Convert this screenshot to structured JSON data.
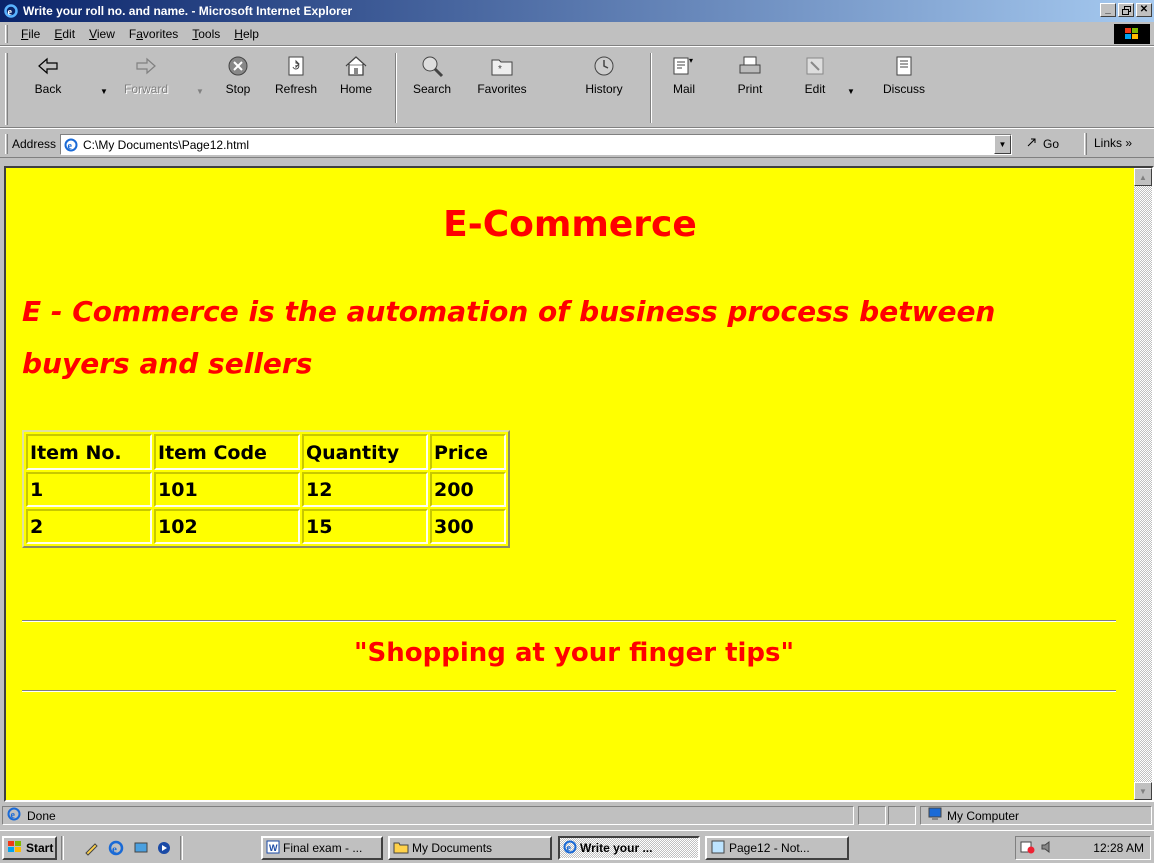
{
  "window": {
    "title": "Write your roll no. and name. - Microsoft Internet Explorer",
    "minimize": "_",
    "maximize": "▫",
    "close": "✕"
  },
  "menu": {
    "items": [
      {
        "label": "File",
        "accel": "F",
        "rest": "ile"
      },
      {
        "label": "Edit",
        "accel": "E",
        "rest": "dit"
      },
      {
        "label": "View",
        "accel": "V",
        "rest": "iew"
      },
      {
        "label": "Favorites",
        "accel": "a",
        "pre": "F",
        "rest": "vorites"
      },
      {
        "label": "Tools",
        "accel": "T",
        "rest": "ools"
      },
      {
        "label": "Help",
        "accel": "H",
        "rest": "elp"
      }
    ]
  },
  "toolbar": {
    "back": "Back",
    "forward": "Forward",
    "stop": "Stop",
    "refresh": "Refresh",
    "home": "Home",
    "search": "Search",
    "favorites": "Favorites",
    "history": "History",
    "mail": "Mail",
    "print": "Print",
    "edit": "Edit",
    "discuss": "Discuss"
  },
  "address": {
    "label": "Address",
    "url": "C:\\My Documents\\Page12.html",
    "go": "Go",
    "links": "Links »"
  },
  "page": {
    "heading": "E-Commerce",
    "description": "E - Commerce is the automation of business process between buyers and sellers",
    "table": {
      "headers": [
        "Item No.",
        "Item Code",
        "Quantity",
        "Price"
      ],
      "rows": [
        [
          "1",
          "101",
          "12",
          "200"
        ],
        [
          "2",
          "102",
          "15",
          "300"
        ]
      ]
    },
    "slogan": "\"Shopping at your finger tips\""
  },
  "status": {
    "text": "Done",
    "zone": "My Computer"
  },
  "taskbar": {
    "start": "Start",
    "tasks": [
      {
        "label": "Final exam - ...",
        "active": false
      },
      {
        "label": "My Documents",
        "active": false
      },
      {
        "label": "Write your ...",
        "active": true
      },
      {
        "label": "Page12 - Not...",
        "active": false
      }
    ],
    "clock": "12:28 AM"
  },
  "colors": {
    "page_background": "#ffff00",
    "heading_text": "#ff0000",
    "title_bar": "#0a246a"
  }
}
